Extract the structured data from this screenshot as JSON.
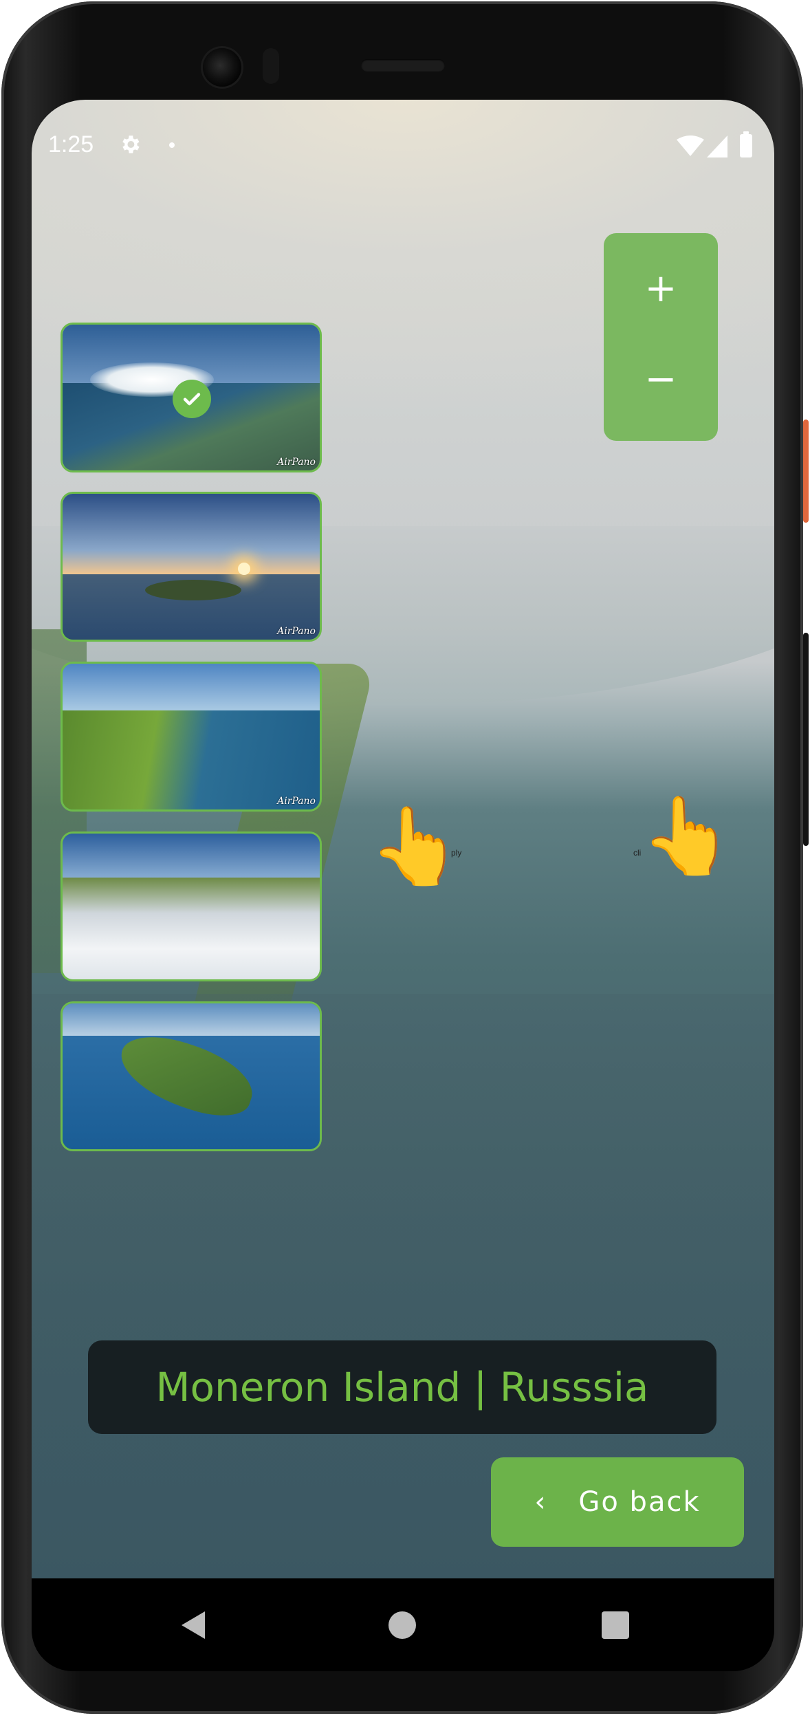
{
  "status_bar": {
    "time": "1:25"
  },
  "zoom": {
    "in_label": "+",
    "out_label": "−"
  },
  "thumbnails": [
    {
      "credit": "AirPano",
      "selected": true
    },
    {
      "credit": "AirPano",
      "selected": false
    },
    {
      "credit": "AirPano",
      "selected": false
    },
    {
      "credit": "",
      "selected": false
    },
    {
      "credit": "",
      "selected": false
    }
  ],
  "hints": {
    "left": "ply",
    "right": "cli"
  },
  "location_title": "Moneron Island | Russsia",
  "go_back": {
    "label": "Go back",
    "chevron": "‹"
  },
  "colors": {
    "accent_green": "#6cb34a",
    "title_green": "#76c043",
    "banner_bg": "#0f1214"
  },
  "icons": [
    "gear-icon",
    "wifi-icon",
    "signal-icon",
    "battery-icon",
    "check-icon",
    "pointing-hand-icon",
    "chevron-left-icon",
    "nav-back-icon",
    "nav-home-icon",
    "nav-recents-icon"
  ]
}
